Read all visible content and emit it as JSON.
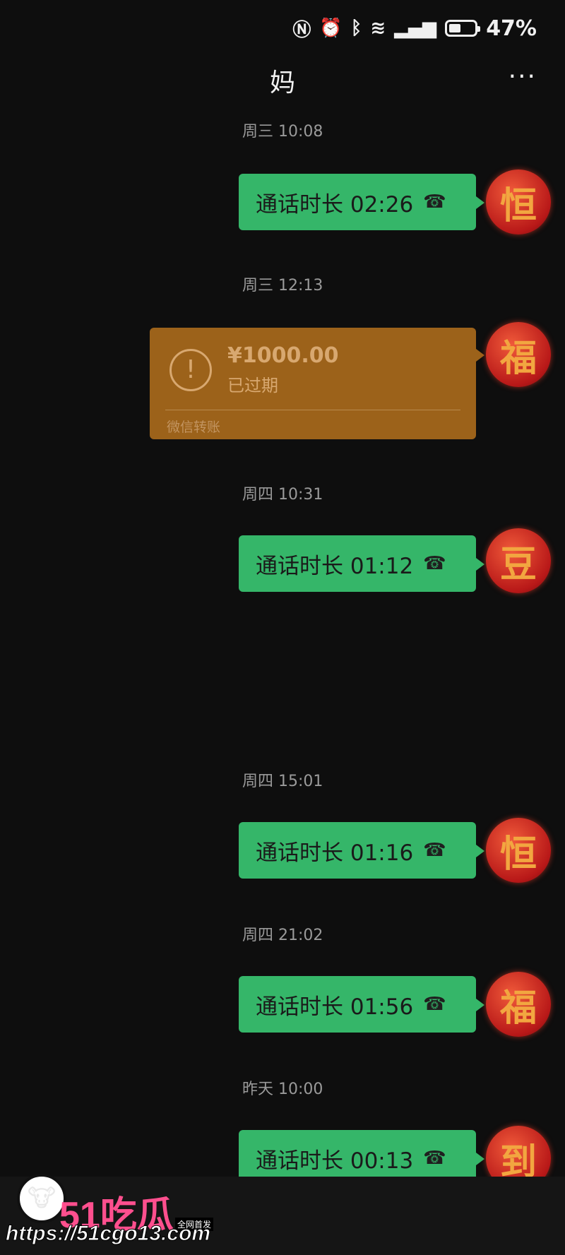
{
  "status_bar": {
    "battery": "47%"
  },
  "header": {
    "title": "妈",
    "more": "···"
  },
  "messages": [
    {
      "time": "周三 10:08",
      "call": "通话时长 02:26",
      "avatar": "恒"
    },
    {
      "time": "周三 12:13",
      "transfer": {
        "amount": "¥1000.00",
        "status": "已过期",
        "label": "微信转账"
      },
      "avatar": "福"
    },
    {
      "time": "周四 10:31",
      "call": "通话时长 01:12",
      "avatar": "豆"
    },
    {
      "time": "周四 15:01",
      "call": "通话时长 01:16",
      "avatar": "恒"
    },
    {
      "time": "周四 21:02",
      "call": "通话时长 01:56",
      "avatar": "福"
    },
    {
      "time": "昨天 10:00",
      "call": "通话时长 00:13",
      "avatar": "到"
    }
  ],
  "watermark": {
    "brand": "51吃瓜",
    "tag": "全网首发",
    "url": "https://51cgo13.com"
  },
  "colors": {
    "bubble": "#35b669",
    "transfer": "#9c621a",
    "background": "#0e0e0e"
  }
}
